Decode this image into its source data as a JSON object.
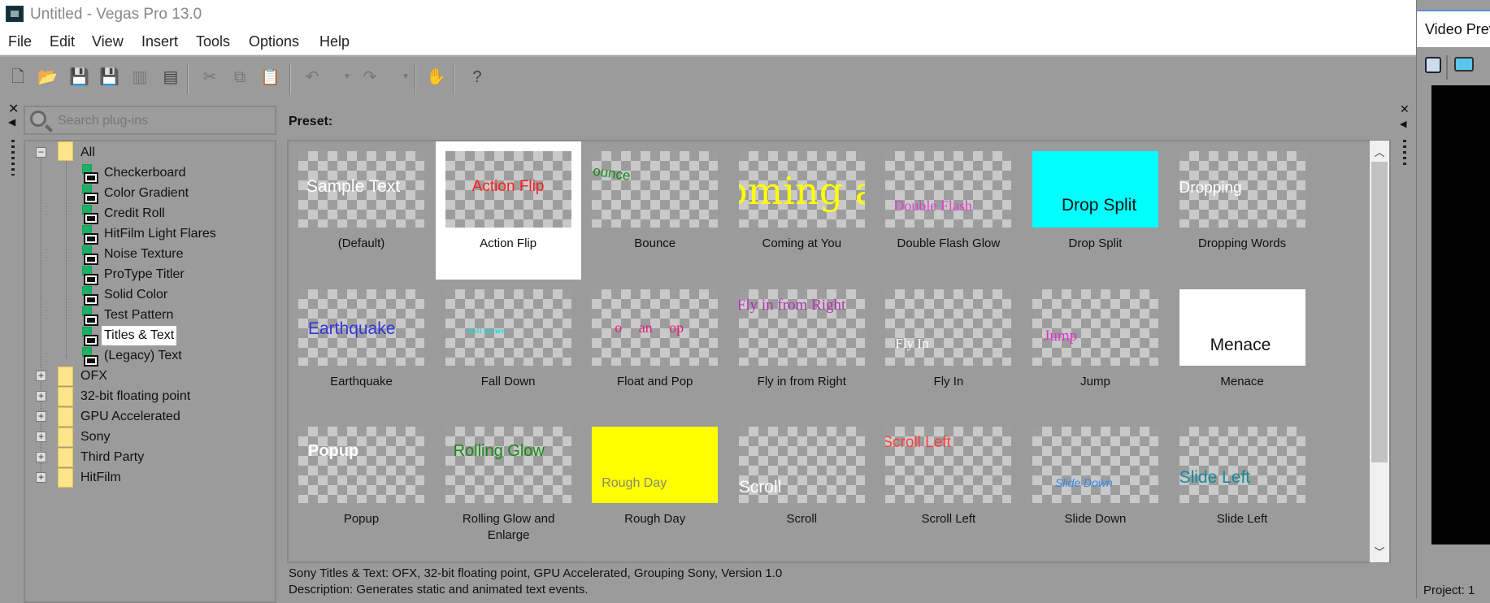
{
  "window": {
    "title": "Untitled - Vegas Pro 13.0"
  },
  "menu": [
    "File",
    "Edit",
    "View",
    "Insert",
    "Tools",
    "Options",
    "Help"
  ],
  "toolbar": {
    "icons": [
      "new-file-icon",
      "open-folder-icon",
      "save-icon",
      "save-as-icon",
      "render-icon",
      "properties-icon",
      "cut-icon",
      "copy-icon",
      "paste-icon",
      "undo-icon",
      "redo-icon",
      "edit-tool-icon",
      "whats-this-help-icon"
    ]
  },
  "search": {
    "placeholder": "Search plug-ins"
  },
  "tree": {
    "root": "All",
    "children": [
      "Checkerboard",
      "Color Gradient",
      "Credit Roll",
      "HitFilm Light Flares",
      "Noise Texture",
      "ProType Titler",
      "Solid Color",
      "Test Pattern",
      "Titles & Text",
      "(Legacy) Text"
    ],
    "selected": "Titles & Text",
    "folders": [
      "OFX",
      "32-bit floating point",
      "GPU Accelerated",
      "Sony",
      "Third Party",
      "HitFilm"
    ]
  },
  "preset_label": "Preset:",
  "presets": [
    {
      "name": "(Default)",
      "thumb": "Sample Text",
      "color": "#ffffff"
    },
    {
      "name": "Action Flip",
      "thumb": "Action Flip",
      "color": "#ff2020",
      "selected": true
    },
    {
      "name": "Bounce",
      "thumb": "Bounce",
      "color": "#1a8a1a"
    },
    {
      "name": "Coming at You",
      "thumb": "Coming at You",
      "color": "#ffff00"
    },
    {
      "name": "Double Flash Glow",
      "thumb": "Double Flash",
      "color": "#e040d0"
    },
    {
      "name": "Drop Split",
      "thumb": "Drop Split",
      "color": "#111111",
      "bg": "#00ffff"
    },
    {
      "name": "Dropping Words",
      "thumb": "Dropping",
      "color": "#ffffff"
    },
    {
      "name": "Earthquake",
      "thumb": "Earthquake",
      "color": "#3333dd"
    },
    {
      "name": "Fall Down",
      "thumb": "Fall Down",
      "color": "#00e0e0"
    },
    {
      "name": "Float and Pop",
      "thumb": "o an op",
      "color": "#e0207a"
    },
    {
      "name": "Fly in from Right",
      "thumb": "Fly in from Right",
      "color": "#b030b0"
    },
    {
      "name": "Fly In",
      "thumb": "Fly In",
      "color": "#ffffff"
    },
    {
      "name": "Jump",
      "thumb": "Jump",
      "color": "#e030d0"
    },
    {
      "name": "Menace",
      "thumb": "Menace",
      "color": "#111111",
      "bg": "#ffffff"
    },
    {
      "name": "Popup",
      "thumb": "Popup",
      "color": "#ffffff"
    },
    {
      "name": "Rolling Glow and Enlarge",
      "thumb": "Rolling Glow",
      "color": "#1a8a1a"
    },
    {
      "name": "Rough Day",
      "thumb": "Rough Day",
      "color": "#8a8a70",
      "bg": "#ffff00"
    },
    {
      "name": "Scroll",
      "thumb": "Scroll",
      "color": "#ffffff"
    },
    {
      "name": "Scroll Left",
      "thumb": "Scroll Left",
      "color": "#ff4040"
    },
    {
      "name": "Slide Down",
      "thumb": "Slide Down",
      "color": "#3388ee"
    },
    {
      "name": "Slide Left",
      "thumb": "Slide Left",
      "color": "#158a9a"
    }
  ],
  "status": {
    "line1": "Sony Titles & Text: OFX, 32-bit floating point, GPU Accelerated, Grouping Sony, Version 1.0",
    "line2": "Description: Generates static and animated text events."
  },
  "video_preview": {
    "title": "Video Preview",
    "project_label": "Project:  1"
  }
}
